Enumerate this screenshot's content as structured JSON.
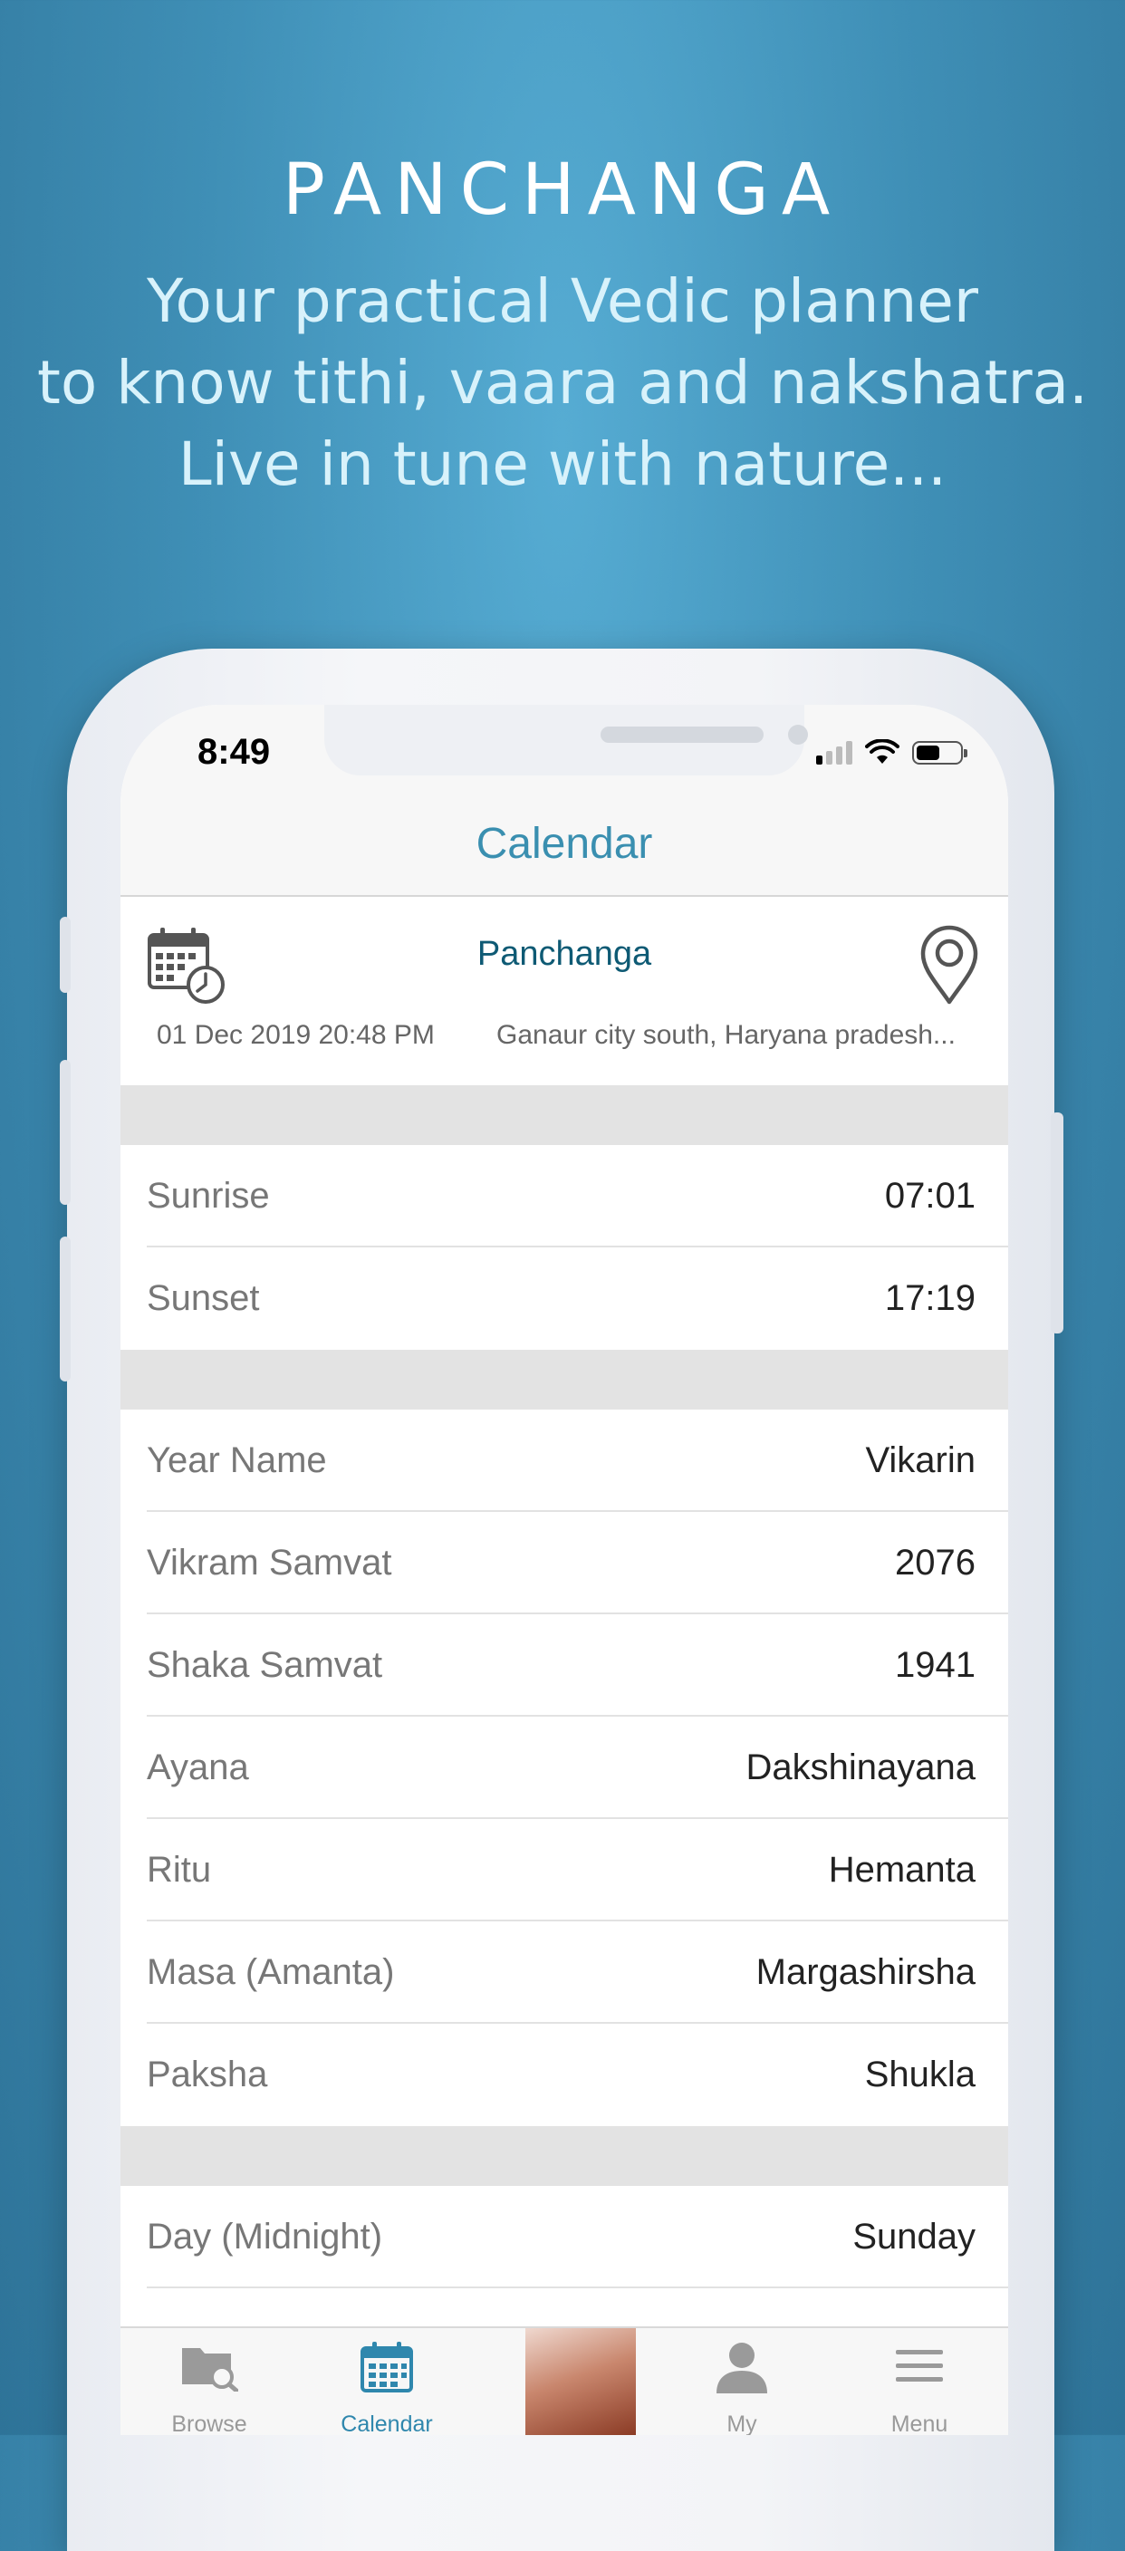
{
  "promo": {
    "title": "PANCHANGA",
    "subtitle_lines": [
      "Your practical Vedic planner",
      "to know tithi, vaara and nakshatra.",
      "Live in tune with nature..."
    ]
  },
  "status_bar": {
    "time": "8:49",
    "battery_level": 0.55
  },
  "nav": {
    "title": "Calendar"
  },
  "header": {
    "title": "Panchanga",
    "date": "01 Dec 2019 20:48 PM",
    "location": "Ganaur city south, Haryana pradesh..."
  },
  "sections": [
    {
      "rows": [
        {
          "label": "Sunrise",
          "value": "07:01"
        },
        {
          "label": "Sunset",
          "value": "17:19"
        }
      ]
    },
    {
      "rows": [
        {
          "label": "Year Name",
          "value": "Vikarin"
        },
        {
          "label": "Vikram Samvat",
          "value": "2076"
        },
        {
          "label": "Shaka Samvat",
          "value": "1941"
        },
        {
          "label": "Ayana",
          "value": "Dakshinayana"
        },
        {
          "label": "Ritu",
          "value": "Hemanta"
        },
        {
          "label": "Masa (Amanta)",
          "value": "Margashirsha"
        },
        {
          "label": "Paksha",
          "value": "Shukla"
        }
      ]
    },
    {
      "rows": [
        {
          "label": "Day (Midnight)",
          "value": "Sunday"
        }
      ]
    }
  ],
  "tabs": [
    {
      "label": "Browse",
      "icon": "folder-search-icon",
      "active": false
    },
    {
      "label": "Calendar",
      "icon": "calendar-icon",
      "active": true
    },
    {
      "label": "",
      "icon": "thumbnail-image",
      "active": false
    },
    {
      "label": "My",
      "icon": "person-icon",
      "active": false
    },
    {
      "label": "Menu",
      "icon": "hamburger-icon",
      "active": false
    }
  ],
  "colors": {
    "accent": "#3a8fb0",
    "tab_active": "#2f87ad",
    "background": "#4a9fc6"
  }
}
